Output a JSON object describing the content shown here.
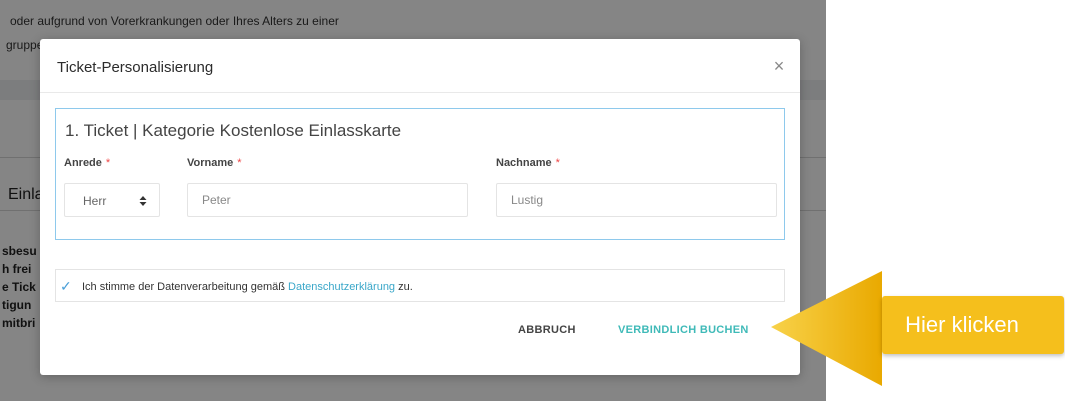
{
  "background": {
    "line1": "oder aufgrund von Vorerkrankungen oder Ihres Alters zu einer",
    "line2": "gruppe...",
    "heading_fragment": "Einla",
    "fragments": [
      "sbesu",
      "h frei",
      "e Tick",
      "tigun",
      "mitbri"
    ]
  },
  "modal": {
    "title": "Ticket-Personalisierung",
    "close_glyph": "×",
    "ticket": {
      "title": "1. Ticket | Kategorie Kostenlose Einlasskarte",
      "anrede_label": "Anrede",
      "vorname_label": "Vorname",
      "nachname_label": "Nachname",
      "required_marker": "*",
      "anrede_value": "Herr",
      "anrede_caret": "⬍",
      "vorname_placeholder": "Peter",
      "nachname_placeholder": "Lustig"
    },
    "consent": {
      "checked_glyph": "✓",
      "text_before": "Ich stimme der Datenverarbeitung gemäß ",
      "link_text": "Datenschutzerklärung",
      "text_after": " zu."
    },
    "buttons": {
      "cancel_label": "ABBRUCH",
      "book_label": "VERBINDLICH BUCHEN"
    }
  },
  "callout": {
    "label": "Hier klicken",
    "color": "#f5bf1c"
  },
  "colors": {
    "accent_teal": "#3fbab8",
    "focus_blue": "#8ec9ec",
    "required_red": "#ee4444"
  }
}
